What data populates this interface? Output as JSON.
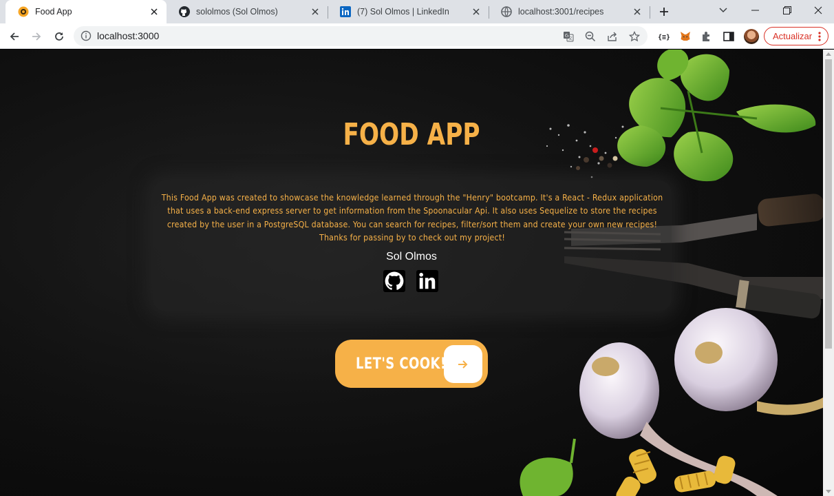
{
  "browser": {
    "tabs": [
      {
        "title": "Food App",
        "favicon": "food-app-icon",
        "active": true
      },
      {
        "title": "sololmos (Sol Olmos)",
        "favicon": "github-icon",
        "active": false
      },
      {
        "title": "(7) Sol Olmos | LinkedIn",
        "favicon": "linkedin-icon",
        "active": false
      },
      {
        "title": "localhost:3001/recipes",
        "favicon": "globe-icon",
        "active": false
      }
    ],
    "address": "localhost:3000",
    "update_label": "Actualizar"
  },
  "page": {
    "title": "FOOD APP",
    "about": "This Food App was created to showcase the knowledge learned through the \"Henry\" bootcamp. It's a React - Redux application that uses a back-end express server to get information from the Spoonacular Api. It also uses Sequelize to store the recipes created by the user in a PostgreSQL database. You can search for recipes, filter/sort them and create your own new recipes! Thanks for passing by to check out my project!",
    "author": "Sol Olmos",
    "cta_label": "LET'S COOK!"
  },
  "colors": {
    "accent": "#f6b148",
    "background": "#121212",
    "update_red": "#d93025"
  }
}
